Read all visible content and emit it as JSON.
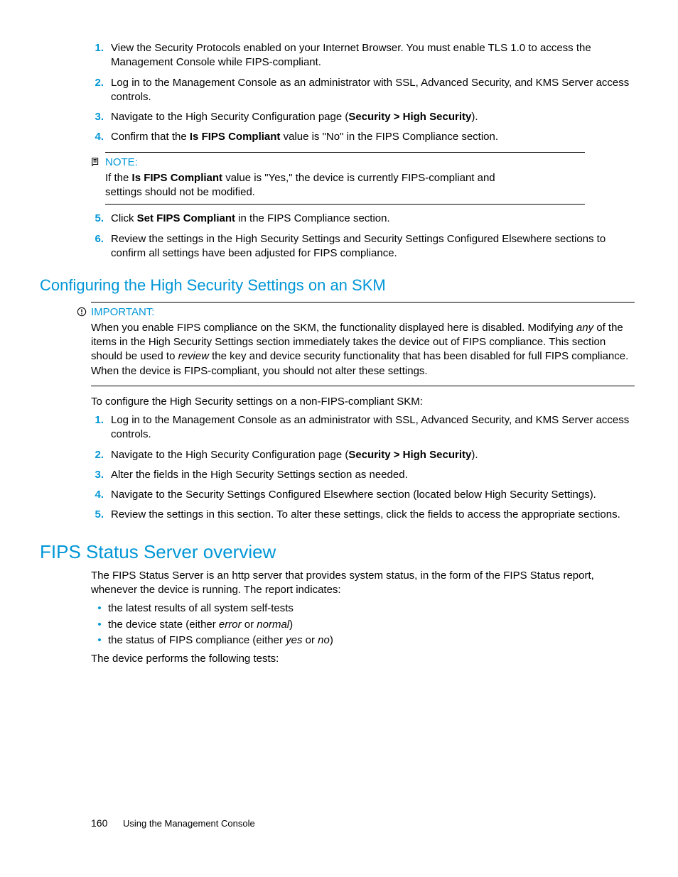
{
  "steps_a": [
    {
      "n": "1.",
      "parts": [
        {
          "t": "View the Security Protocols enabled on your Internet Browser.  You must enable TLS 1.0 to access the Management Console while FIPS-compliant."
        }
      ]
    },
    {
      "n": "2.",
      "parts": [
        {
          "t": "Log in to the Management Console as an administrator with SSL, Advanced Security, and KMS Server access controls."
        }
      ]
    },
    {
      "n": "3.",
      "parts": [
        {
          "t": "Navigate to the High Security Configuration page ("
        },
        {
          "t": "Security > High Security",
          "b": true
        },
        {
          "t": ")."
        }
      ]
    },
    {
      "n": "4.",
      "parts": [
        {
          "t": "Confirm that the "
        },
        {
          "t": "Is FIPS Compliant",
          "b": true
        },
        {
          "t": " value is \"No\" in the FIPS Compliance section."
        }
      ]
    }
  ],
  "note": {
    "label": "NOTE:",
    "body_parts": [
      {
        "t": "If the "
      },
      {
        "t": "Is FIPS Compliant",
        "b": true
      },
      {
        "t": " value is \"Yes,\" the device is currently FIPS-compliant and settings should not be modified."
      }
    ]
  },
  "steps_b": [
    {
      "n": "5.",
      "parts": [
        {
          "t": "Click "
        },
        {
          "t": "Set FIPS Compliant",
          "b": true
        },
        {
          "t": " in the FIPS Compliance section."
        }
      ]
    },
    {
      "n": "6.",
      "parts": [
        {
          "t": "Review the settings in the High Security Settings and Security Settings Configured Elsewhere sections to confirm all settings have been adjusted for FIPS compliance."
        }
      ]
    }
  ],
  "heading_sub": "Configuring the High Security Settings on an SKM",
  "important": {
    "label": "IMPORTANT:",
    "body_parts": [
      {
        "t": "When you enable FIPS compliance on the SKM, the functionality displayed here is disabled.  Modifying "
      },
      {
        "t": "any",
        "i": true
      },
      {
        "t": " of the items in the High Security Settings section immediately takes the device out of FIPS compliance. This section should be used to "
      },
      {
        "t": "review",
        "i": true
      },
      {
        "t": " the key and device security functionality that has been disabled for full FIPS compliance.  When the device is FIPS-compliant, you should not alter these settings."
      }
    ]
  },
  "para_intro": "To configure the High Security settings on a non-FIPS-compliant SKM:",
  "steps_c": [
    {
      "n": "1.",
      "parts": [
        {
          "t": "Log in to the Management Console as an administrator with SSL, Advanced Security, and KMS Server access controls."
        }
      ]
    },
    {
      "n": "2.",
      "parts": [
        {
          "t": "Navigate to the High Security Configuration page ("
        },
        {
          "t": "Security > High Security",
          "b": true
        },
        {
          "t": ")."
        }
      ]
    },
    {
      "n": "3.",
      "parts": [
        {
          "t": "Alter the fields in the High Security Settings section as needed."
        }
      ]
    },
    {
      "n": "4.",
      "parts": [
        {
          "t": "Navigate to the Security Settings Configured Elsewhere section (located below High Security Settings)."
        }
      ]
    },
    {
      "n": "5.",
      "parts": [
        {
          "t": "Review the settings in this section.  To alter these settings, click the fields to access the appropriate sections."
        }
      ]
    }
  ],
  "heading_main": "FIPS Status Server overview",
  "para_fips1": "The FIPS Status Server is an http server that provides system status, in the form of the FIPS Status report, whenever the device is running.  The report indicates:",
  "bullets": [
    [
      {
        "t": "the latest results of all system self-tests"
      }
    ],
    [
      {
        "t": "the device state (either "
      },
      {
        "t": "error",
        "i": true
      },
      {
        "t": " or "
      },
      {
        "t": "normal",
        "i": true
      },
      {
        "t": ")"
      }
    ],
    [
      {
        "t": "the status of FIPS compliance (either "
      },
      {
        "t": "yes",
        "i": true
      },
      {
        "t": " or "
      },
      {
        "t": "no",
        "i": true
      },
      {
        "t": ")"
      }
    ]
  ],
  "para_fips2": "The device performs the following tests:",
  "footer": {
    "page": "160",
    "text": "Using the Management Console"
  }
}
